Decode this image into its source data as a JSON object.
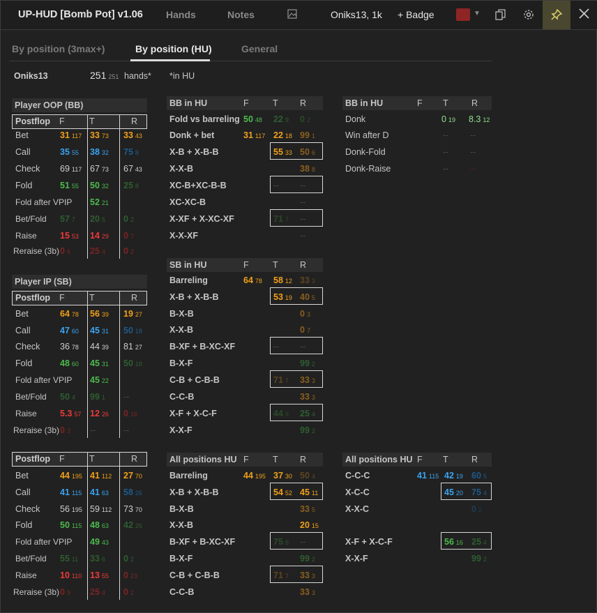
{
  "titlebar": {
    "title": "UP-HUD [Bomb Pot] v1.06",
    "hands": "Hands",
    "notes": "Notes",
    "player_label": "Oniks13, 1k",
    "badge": "+ Badge",
    "icon_image": "image-icon",
    "icon_copy": "copy-icon",
    "icon_settings": "gear-icon",
    "icon_pin": "pin-icon",
    "icon_close": "close-icon",
    "swatch_color": "#8e2424"
  },
  "tabs": [
    "By position (3max+)",
    "By position (HU)",
    "General"
  ],
  "summary": {
    "player": "Oniks13",
    "hands": "251",
    "hands_sub": "251",
    "hands_label": "hands*",
    "note": "*in HU"
  },
  "labels": {
    "player_oop": "Player OOP (BB)",
    "player_ip": "Player IP (SB)",
    "postflop": "Postflop",
    "F": "F",
    "T": "T",
    "R": "R",
    "bb_in_hu": "BB in HU",
    "sb_in_hu": "SB in HU",
    "all_hu": "All positions HU"
  },
  "rows": {
    "bet": "Bet",
    "call": "Call",
    "check": "Check",
    "fold": "Fold",
    "fold_vpip": "Fold after VPIP",
    "betfold": "Bet/Fold",
    "raise": "Raise",
    "reraise": "Reraise (3b)",
    "fold_vs_barreling": "Fold vs barreling",
    "donk_bet": "Donk + bet",
    "xb_xbb": "X-B + X-B-B",
    "xxb": "X-X-B",
    "xcb_xcbb": "XC-B+XC-B-B",
    "xc_xc_xb": "XC-XC-B",
    "xxf_xxcxf": "X-XF + X-XC-XF",
    "xxxf": "X-X-XF",
    "barreling": "Barreling",
    "bxb": "B-X-B",
    "bxf_bxcxf": "B-XF + B-XC-XF",
    "bxf": "B-X-F",
    "cb_cbb": "C-B + C-B-B",
    "ccb": "C-C-B",
    "xf_xcf": "X-F + X-C-F",
    "xxf": "X-X-F",
    "donk": "Donk",
    "win_after_d": "Win after D",
    "donk_fold": "Donk-Fold",
    "donk_raise": "Donk-Raise",
    "ccc": "C-C-C",
    "xcc": "X-C-C",
    "xxc": "X-X-C",
    "xf_xcf2": "X-F + X-C-F",
    "xxf2": "X-X-F"
  },
  "v": {
    "oop": {
      "bet": [
        "31",
        "117",
        "33",
        "73",
        "33",
        "43"
      ],
      "call": [
        "35",
        "55",
        "38",
        "32",
        "75",
        "8"
      ],
      "check": [
        "69",
        "117",
        "67",
        "73",
        "67",
        "43"
      ],
      "fold": [
        "51",
        "55",
        "50",
        "32",
        "25",
        "8"
      ],
      "fvpip": [
        "52",
        "21"
      ],
      "bf": [
        "57",
        "7",
        "20",
        "5",
        "0",
        "2"
      ],
      "raise": [
        "15",
        "53",
        "14",
        "29",
        "0",
        "7"
      ],
      "rr": [
        "0",
        "6",
        "25",
        "4",
        "0",
        "2"
      ]
    },
    "ip": {
      "bet": [
        "64",
        "78",
        "56",
        "39",
        "19",
        "27"
      ],
      "call": [
        "47",
        "60",
        "45",
        "31",
        "50",
        "18"
      ],
      "check": [
        "36",
        "78",
        "44",
        "39",
        "81",
        "27"
      ],
      "fold": [
        "48",
        "60",
        "45",
        "31",
        "50",
        "18"
      ],
      "fvpip": [
        "45",
        "22"
      ],
      "bf": [
        "50",
        "4",
        "99",
        "1",
        "--"
      ],
      "raise": [
        "5.3",
        "57",
        "12",
        "26",
        "0",
        "16"
      ],
      "rr": [
        "0",
        "3",
        "--",
        "--"
      ]
    },
    "all": {
      "bet": [
        "44",
        "195",
        "41",
        "112",
        "27",
        "70"
      ],
      "call": [
        "41",
        "115",
        "41",
        "63",
        "58",
        "26"
      ],
      "check": [
        "56",
        "195",
        "59",
        "112",
        "73",
        "70"
      ],
      "fold": [
        "50",
        "115",
        "48",
        "63",
        "42",
        "26"
      ],
      "fvpip": [
        "49",
        "43"
      ],
      "bf": [
        "55",
        "11",
        "33",
        "6",
        "0",
        "2"
      ],
      "raise": [
        "10",
        "110",
        "13",
        "55",
        "0",
        "23"
      ],
      "rr": [
        "0",
        "9",
        "25",
        "4",
        "0",
        "2"
      ]
    },
    "bbhu": {
      "fvb": [
        "50",
        "48",
        "22",
        "9",
        "0",
        "2"
      ],
      "donk": [
        "31",
        "117",
        "22",
        "18",
        "99",
        "1"
      ],
      "xb": [
        "55",
        "33",
        "50",
        "6"
      ],
      "xxb": [
        "38",
        "8"
      ],
      "xcb": [
        "--",
        "--"
      ],
      "xcxc": [
        "--"
      ],
      "xxf": [
        "71",
        "7",
        "--"
      ],
      "xxxf": [
        "--"
      ]
    },
    "sbhu": {
      "bar": [
        "64",
        "78",
        "58",
        "12",
        "33",
        "3"
      ],
      "xb": [
        "53",
        "19",
        "40",
        "5"
      ],
      "bxb": [
        "0",
        "3"
      ],
      "xxb": [
        "0",
        "7"
      ],
      "bxf": [
        "--",
        "--"
      ],
      "bxf2": [
        "99",
        "2"
      ],
      "cb": [
        "71",
        "7",
        "33",
        "3"
      ],
      "ccb": [
        "33",
        "3"
      ],
      "xf": [
        "44",
        "9",
        "25",
        "4"
      ],
      "xxf": [
        "99",
        "2"
      ]
    },
    "allhu": {
      "bar": [
        "44",
        "195",
        "37",
        "30",
        "50",
        "4"
      ],
      "xb": [
        "54",
        "52",
        "45",
        "11"
      ],
      "bxb": [
        "33",
        "5"
      ],
      "xxb": [
        "20",
        "15"
      ],
      "bxf": [
        "75",
        "8",
        "--"
      ],
      "bxf2": [
        "99",
        "2"
      ],
      "cb": [
        "71",
        "7",
        "33",
        "3"
      ],
      "ccb": [
        "33",
        "3"
      ]
    },
    "bbd": {
      "donk": [
        "0",
        "19",
        "8.3",
        "12"
      ],
      "win": [
        "--",
        "--"
      ],
      "df": [
        "--",
        "--"
      ],
      "dr": [
        "--",
        "--"
      ]
    },
    "allhu2": {
      "ccc": [
        "41",
        "115",
        "42",
        "19",
        "60",
        "5"
      ],
      "xcc": [
        "45",
        "20",
        "75",
        "4"
      ],
      "xxc": [
        "0",
        "2"
      ],
      "xf": [
        "56",
        "16",
        "25",
        "4"
      ],
      "xxf": [
        "99",
        "2"
      ]
    }
  }
}
